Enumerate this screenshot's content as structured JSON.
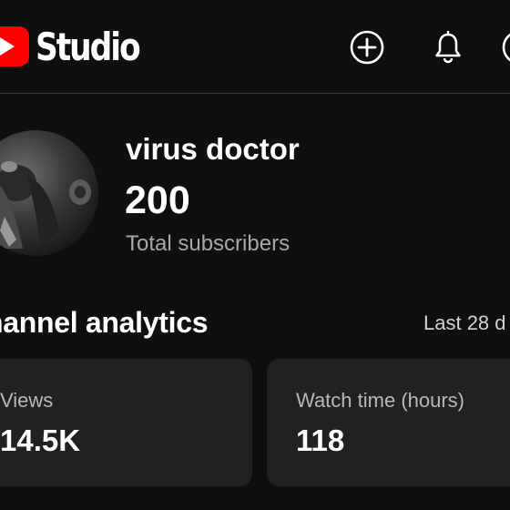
{
  "header": {
    "app_name": "Studio",
    "icons": [
      "youtube-logo-icon",
      "create-icon",
      "notifications-bell-icon",
      "more-icon"
    ]
  },
  "channel": {
    "name": "virus doctor",
    "subscriber_count": "200",
    "subscriber_label": "Total subscribers"
  },
  "analytics": {
    "title": "hannel analytics",
    "period": "Last 28 d",
    "cards": [
      {
        "label": "Views",
        "value": "14.5K"
      },
      {
        "label": "Watch time (hours)",
        "value": "118"
      }
    ]
  },
  "colors": {
    "background": "#0f0f0f",
    "card": "#212121",
    "brand_red": "#ff0000",
    "secondary_text": "#a8a8a8"
  }
}
